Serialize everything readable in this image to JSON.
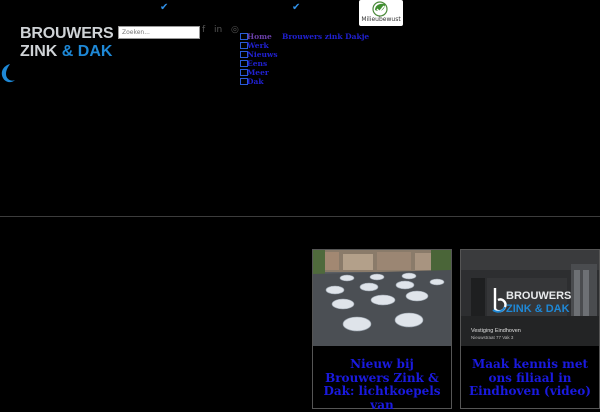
{
  "logo": {
    "line1": "BROUWERS",
    "line2_a": "ZINK",
    "line2_amp": "&",
    "line2_b": "DAK"
  },
  "topbar": {
    "checkmarks": [
      "✔",
      "✔"
    ],
    "search_placeholder": "Zoeken...",
    "social": [
      "f",
      "in",
      "◎"
    ],
    "badge_label": "Milieubewust"
  },
  "nav": {
    "items": [
      "Home",
      "Werk",
      "Nieuws",
      "Eens",
      "Meer",
      "Dak"
    ],
    "extra": "Brouwers zink Dakje"
  },
  "cards": [
    {
      "title": "Nieuw bij Brouwers Zink & Dak: lichtkoepels van"
    },
    {
      "title": "Maak kennis met ons filiaal in Eindhoven (video)",
      "image_logo_line1": "BROUWERS",
      "image_logo_line2": "ZINK & DAK",
      "caption_line1": "Vestiging Eindhoven",
      "caption_line2": "Nieuwstraat 77 Vak 3"
    }
  ],
  "colors": {
    "accent": "#1e88d6",
    "link": "#2020d0",
    "background": "#000000"
  }
}
